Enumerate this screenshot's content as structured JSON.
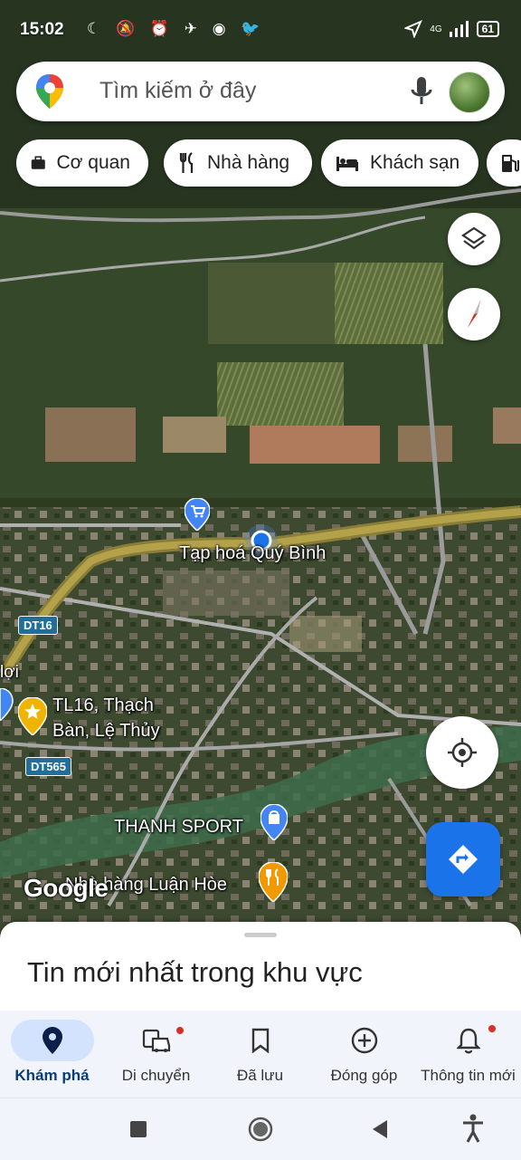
{
  "status_bar": {
    "time": "15:02",
    "left_icons": "☾ 🔕 ⏰ ✈ ◉ 🐦",
    "network": "4G",
    "battery": "61"
  },
  "search": {
    "placeholder": "Tìm kiếm ở đây"
  },
  "chips": [
    {
      "label": "Cơ quan",
      "icon": "briefcase-icon"
    },
    {
      "label": "Nhà hàng",
      "icon": "fork-knife-icon"
    },
    {
      "label": "Khách sạn",
      "icon": "bed-icon"
    },
    {
      "label": "",
      "icon": "gas-station-icon"
    }
  ],
  "map": {
    "labels": {
      "store": "Tạp hoá Quý Bình",
      "location_line1": "TL16, Thạch",
      "location_line2": "Bàn, Lệ Thủy",
      "sport": "THANH SPORT",
      "restaurant": "Nhà hàng Luận Hòe",
      "edge_text": "lợi"
    },
    "road_shields": [
      "DT16",
      "DT565"
    ],
    "watermark": "Google"
  },
  "sheet": {
    "title": "Tin mới nhất trong khu vực"
  },
  "nav": [
    {
      "label": "Khám phá",
      "icon": "location-pin-icon",
      "active": true
    },
    {
      "label": "Di chuyển",
      "icon": "commute-icon",
      "badge": true
    },
    {
      "label": "Đã lưu",
      "icon": "bookmark-icon"
    },
    {
      "label": "Đóng góp",
      "icon": "add-circle-icon"
    },
    {
      "label": "Thông tin mới",
      "icon": "bell-icon",
      "badge": true
    }
  ],
  "colors": {
    "accent": "#1a73e8",
    "nav_active_bg": "#d3e3fd",
    "badge": "#d93025"
  }
}
